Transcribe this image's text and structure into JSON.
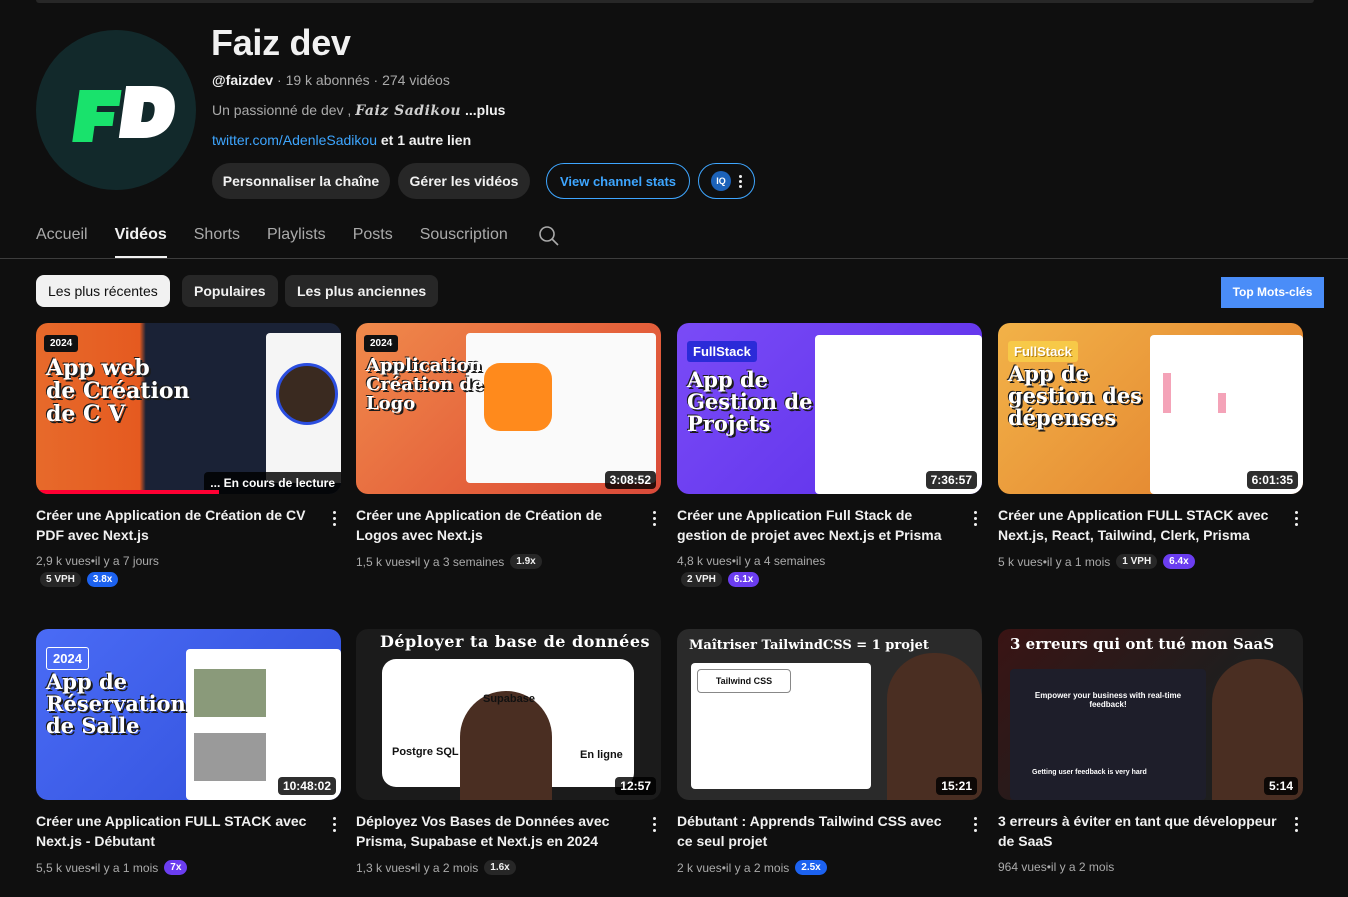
{
  "channel": {
    "name": "Faiz dev",
    "avatar_text": "FD",
    "handle": "@faizdev",
    "subscribers": "19 k abonnés",
    "videos_count": "274 vidéos",
    "description": "Un passionné de dev ,",
    "signature": "Faiz Sadikou",
    "more": "...plus",
    "link": "twitter.com/AdenleSadikou",
    "other_links": "et 1 autre lien"
  },
  "buttons": {
    "customize": "Personnaliser la chaîne",
    "manage": "Gérer les vidéos",
    "stats": "View channel stats",
    "ext_badge": "IQ"
  },
  "tabs": [
    "Accueil",
    "Vidéos",
    "Shorts",
    "Playlists",
    "Posts",
    "Souscription"
  ],
  "active_tab": "Vidéos",
  "chips": [
    "Les plus récentes",
    "Populaires",
    "Les plus anciennes"
  ],
  "top_keywords": "Top Mots-clés",
  "videos": [
    {
      "title": "Créer une Application de Création de CV PDF avec Next.js",
      "views": "2,9 k vues",
      "age": "il y a 7 jours",
      "badge": "2024",
      "thumb_lines": [
        "App web",
        "de Création",
        "de C V"
      ],
      "status": "... En cours de lecture",
      "vph": "5 VPH",
      "ratio": "3.8x",
      "progress": 0.6,
      "colors": {
        "bg": "#e76a2b",
        "accent": "#1a2236"
      }
    },
    {
      "title": "Créer une Application de Création de Logos avec Next.js",
      "views": "1,5 k vues",
      "age": "il y a 3 semaines",
      "badge": "2024",
      "thumb_lines": [
        "Application",
        "Création de",
        "Logo"
      ],
      "duration": "3:08:52",
      "ratio": "1.9x",
      "colors": {
        "bg": "#e46d3e",
        "accent": "#ffb347"
      }
    },
    {
      "title": "Créer une Application Full Stack de gestion de projet avec Next.js et Prisma",
      "views": "4,8 k vues",
      "age": "il y a 4 semaines",
      "badge": "FullStack",
      "thumb_lines": [
        "App de",
        "Gestion de",
        "Projets"
      ],
      "duration": "7:36:57",
      "vph": "2 VPH",
      "ratio": "6.1x",
      "colors": {
        "bg": "#6d3df5",
        "accent": "#ffffff"
      }
    },
    {
      "title": "Créer une Application FULL STACK avec Next.js, React, Tailwind, Clerk, Prisma",
      "views": "5 k vues",
      "age": "il y a 1 mois",
      "badge": "FullStack",
      "thumb_lines": [
        "App de",
        "gestion des",
        "dépenses"
      ],
      "duration": "6:01:35",
      "vph": "1 VPH",
      "ratio": "6.4x",
      "colors": {
        "bg": "#f0a030",
        "accent": "#ffffff"
      }
    },
    {
      "title": "Créer une Application FULL STACK avec Next.js - Débutant",
      "views": "5,5 k vues",
      "age": "il y a 1 mois",
      "badge": "2024",
      "thumb_lines": [
        "App de",
        "Réservation",
        "de Salle"
      ],
      "duration": "10:48:02",
      "ratio": "7x",
      "colors": {
        "bg": "#3f5ff0",
        "accent": "#ffffff"
      }
    },
    {
      "title": "Déployez Vos Bases de Données avec Prisma, Supabase et Next.js en 2024",
      "views": "1,3 k vues",
      "age": "il y a 2 mois",
      "thumb_lines": [
        "Déployer ta base de données"
      ],
      "labels": [
        "Supabase",
        "Postgre SQL",
        "En ligne"
      ],
      "duration": "12:57",
      "ratio": "1.6x",
      "colors": {
        "bg": "#1b1b1b",
        "accent": "#ffffff"
      }
    },
    {
      "title": "Débutant : Apprends Tailwind CSS avec ce seul projet",
      "views": "2 k vues",
      "age": "il y a 2 mois",
      "thumb_lines": [
        "Maîtriser TailwindCSS = 1 projet"
      ],
      "labels": [
        "Tailwind CSS"
      ],
      "duration": "15:21",
      "ratio": "2.5x",
      "colors": {
        "bg": "#2a2a2a",
        "accent": "#ffffff"
      }
    },
    {
      "title": "3 erreurs à éviter en tant que développeur de SaaS",
      "views": "964 vues",
      "age": "il y a 2 mois",
      "thumb_lines": [
        "3 erreurs qui ont tué mon SaaS"
      ],
      "labels": [
        "Empower your business with real-time feedback!",
        "Getting user feedback is very hard"
      ],
      "duration": "5:14",
      "colors": {
        "bg": "#c0392b",
        "accent": "#1e1e1e"
      }
    }
  ]
}
